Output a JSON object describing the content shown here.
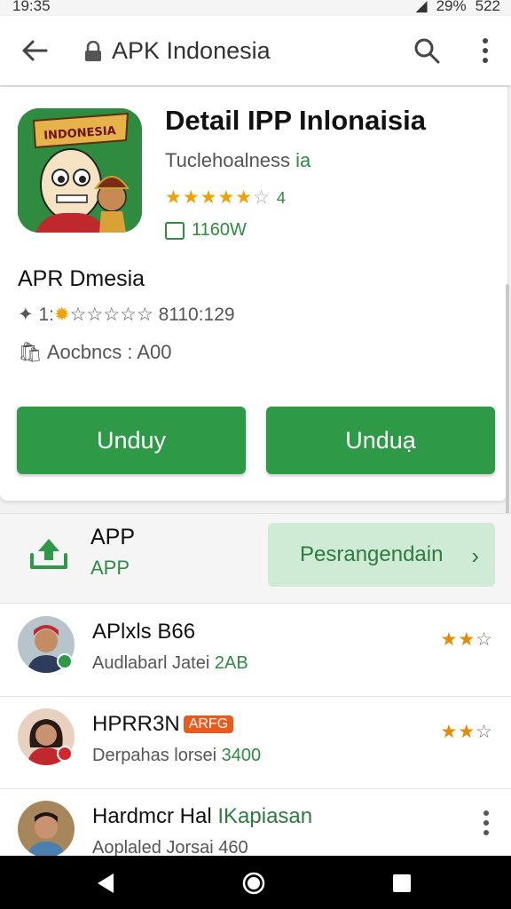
{
  "status_bar": {
    "time": "19:35",
    "battery": "29%",
    "right_text": "522"
  },
  "top_bar": {
    "title": "APK Indonesia",
    "icons": [
      "back-arrow-icon",
      "lock-icon",
      "search-icon",
      "more-vert-icon"
    ]
  },
  "app": {
    "title": "Detail IPP Inlonaisia",
    "developer_prefix": "Tuclehoalness",
    "developer_suffix": "ia",
    "rating_stars": 4.5,
    "rating_num": "4",
    "size": "1160W",
    "icon_banner": "INDONESIA",
    "sub_name": "APR Dmesia",
    "rating_line_prefix": "1:",
    "rating_line_value": "8110:129",
    "access_line": "Aocbncs : A00",
    "btn1": "Unduy",
    "btn2": "Unduạ"
  },
  "app_bar": {
    "label1": "APP",
    "label2": "APP",
    "pill": "Pesrangendain",
    "pill_chevron": "›"
  },
  "list": [
    {
      "name": "APlxls B66",
      "sub_prefix": "Audlabarl Jatei",
      "sub_suffix": "2AB",
      "stars_on": 2,
      "stars_total": 3
    },
    {
      "name": "HPRR3N",
      "badge": "ARFG",
      "sub_prefix": "Derpahas lorsei",
      "sub_suffix": "3400",
      "stars_on": 2,
      "stars_total": 3
    },
    {
      "name": "Hardmcr Hal",
      "name_suffix": "IKapiasan",
      "sub_prefix": "Aoplaled Jorsai 460",
      "sub_suffix": ""
    }
  ],
  "colors": {
    "accent_green": "#2e9a48",
    "star_orange": "#f0a000",
    "badge_orange": "#e85a1d"
  }
}
